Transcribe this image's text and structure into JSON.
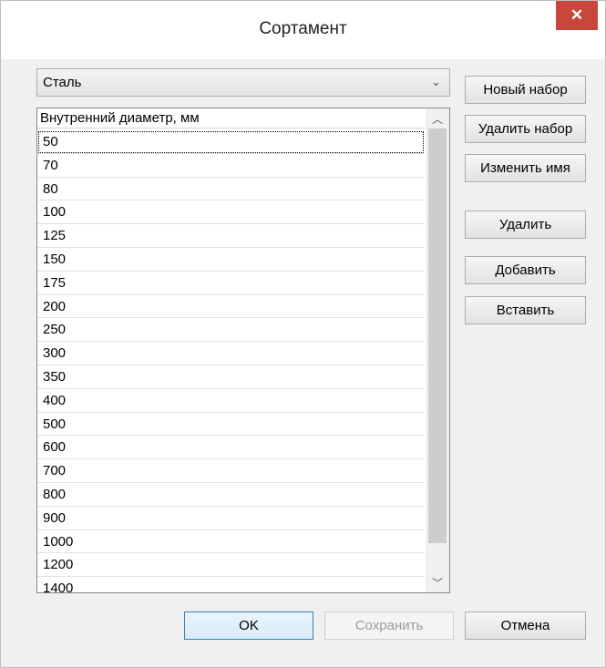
{
  "window": {
    "title": "Сортамент",
    "close_glyph": "✕"
  },
  "material": {
    "selected": "Сталь",
    "chevron": "⌄"
  },
  "side_buttons": {
    "new_set": "Новый набор",
    "delete_set": "Удалить набор",
    "rename": "Изменить имя",
    "delete": "Удалить",
    "add": "Добавить",
    "insert": "Вставить"
  },
  "list": {
    "header": "Внутренний диаметр, мм",
    "rows": [
      "50",
      "70",
      "80",
      "100",
      "125",
      "150",
      "175",
      "200",
      "250",
      "300",
      "350",
      "400",
      "500",
      "600",
      "700",
      "800",
      "900",
      "1000",
      "1200",
      "1400"
    ]
  },
  "scroll": {
    "up": "︿",
    "down": "﹀"
  },
  "footer": {
    "ok": "OK",
    "save": "Сохранить",
    "cancel": "Отмена"
  }
}
